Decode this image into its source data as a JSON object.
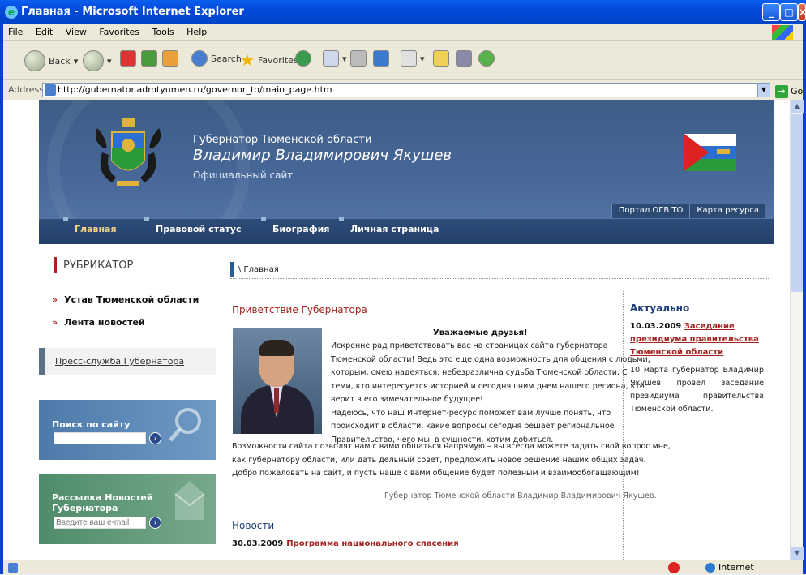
{
  "window": {
    "title": "Главная - Microsoft Internet Explorer"
  },
  "menu": [
    "File",
    "Edit",
    "View",
    "Favorites",
    "Tools",
    "Help"
  ],
  "toolbar": {
    "back": "Back",
    "search": "Search",
    "favorites": "Favorites"
  },
  "address": {
    "label": "Address",
    "url": "http://gubernator.admtyumen.ru/governor_to/main_page.htm",
    "go": "Go"
  },
  "header": {
    "line1": "Губернатор Тюменской области",
    "line2": "Владимир Владимирович Якушев",
    "line3": "Официальный сайт",
    "links": [
      "Портал ОГВ ТО",
      "Карта ресурса"
    ]
  },
  "nav": [
    "Главная",
    "Правовой статус",
    "Биография",
    "Личная страница"
  ],
  "left": {
    "rubric": "РУБРИКАТОР",
    "links": [
      "Устав Тюменской области",
      "Лента новостей"
    ],
    "press": "Пресс-служба Губернатора",
    "search_label": "Поиск по сайту",
    "news_label": "Рассылка Новостей Губернатора",
    "news_placeholder": "Введите ваш e-mail"
  },
  "main": {
    "breadcrumb": "\\ Главная",
    "greeting_title": "Приветствие Губернатора",
    "greeting_head": "Уважаемые друзья!",
    "p1_lines": [
      "Искренне рад приветствовать вас на страницах сайта губернатора",
      "Тюменской области! Ведь это еще одна возможность для общения с людьми,",
      "которым, смею надеяться, небезразлична судьба Тюменской области. С",
      "теми, кто интересуется историей и сегодняшним днем нашего региона, кто",
      "верит в его замечательное будущее!",
      "Надеюсь, что наш Интернет-ресурс поможет вам лучше понять, что",
      "происходит в области, какие вопросы сегодня решает региональное",
      "Правительство, чего мы, в сущности, хотим добиться."
    ],
    "p2_lines": [
      "Возможности сайта позволят нам с вами общаться напрямую – вы всегда можете задать свой вопрос мне,",
      "как губернатору области, или дать дельный совет, предложить новое решение наших общих задач.",
      "Добро пожаловать на сайт, и пусть наше с вами общение будет полезным и взаимообогащающим!"
    ],
    "signature": "Губернатор Тюменской области Владимир Владимирович Якушев.",
    "news_title": "Новости",
    "news_date": "30.03.2009",
    "news_link": "Программа национального спасения"
  },
  "aside": {
    "title": "Актуально",
    "date": "10.03.2009",
    "link": "Заседание президиума правительства Тюменской области",
    "text": "10 марта губернатор Владимир Якушев провел заседание президиума правительства Тюменской области."
  },
  "status": {
    "zone": "Internet"
  }
}
